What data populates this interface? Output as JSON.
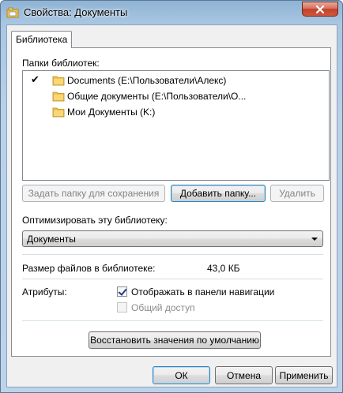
{
  "window": {
    "title": "Свойства: Документы",
    "close_icon": "close-icon",
    "app_icon": "library-icon"
  },
  "tabs": [
    {
      "label": "Библиотека"
    }
  ],
  "library": {
    "folders_label": "Папки библиотек:",
    "folders": [
      {
        "name": "Documents (E:\\Пользователи\\Алекс)",
        "checked": true,
        "check_glyph": "✔"
      },
      {
        "name": "Общие документы (E:\\Пользователи\\О...",
        "checked": false,
        "check_glyph": ""
      },
      {
        "name": "Мои Документы (K:)",
        "checked": false,
        "check_glyph": ""
      }
    ],
    "buttons": {
      "set_save": "Задать папку для сохранения",
      "add_folder": "Добавить папку...",
      "remove": "Удалить"
    },
    "optimize_label": "Оптимизировать эту библиотеку:",
    "optimize_value": "Документы",
    "size_label": "Размер файлов в библиотеке:",
    "size_value": "43,0 КБ",
    "attributes_label": "Атрибуты:",
    "show_in_nav": {
      "label": "Отображать в панели навигации",
      "checked": true
    },
    "shared": {
      "label": "Общий доступ",
      "checked": false,
      "disabled": true
    },
    "restore_defaults": "Восстановить значения по умолчанию"
  },
  "dialog_buttons": {
    "ok": "ОК",
    "cancel": "Отмена",
    "apply": "Применить"
  },
  "colors": {
    "folder": "#f3c24a",
    "close_button": "#c4412b",
    "focus": "#3c7fb1"
  }
}
